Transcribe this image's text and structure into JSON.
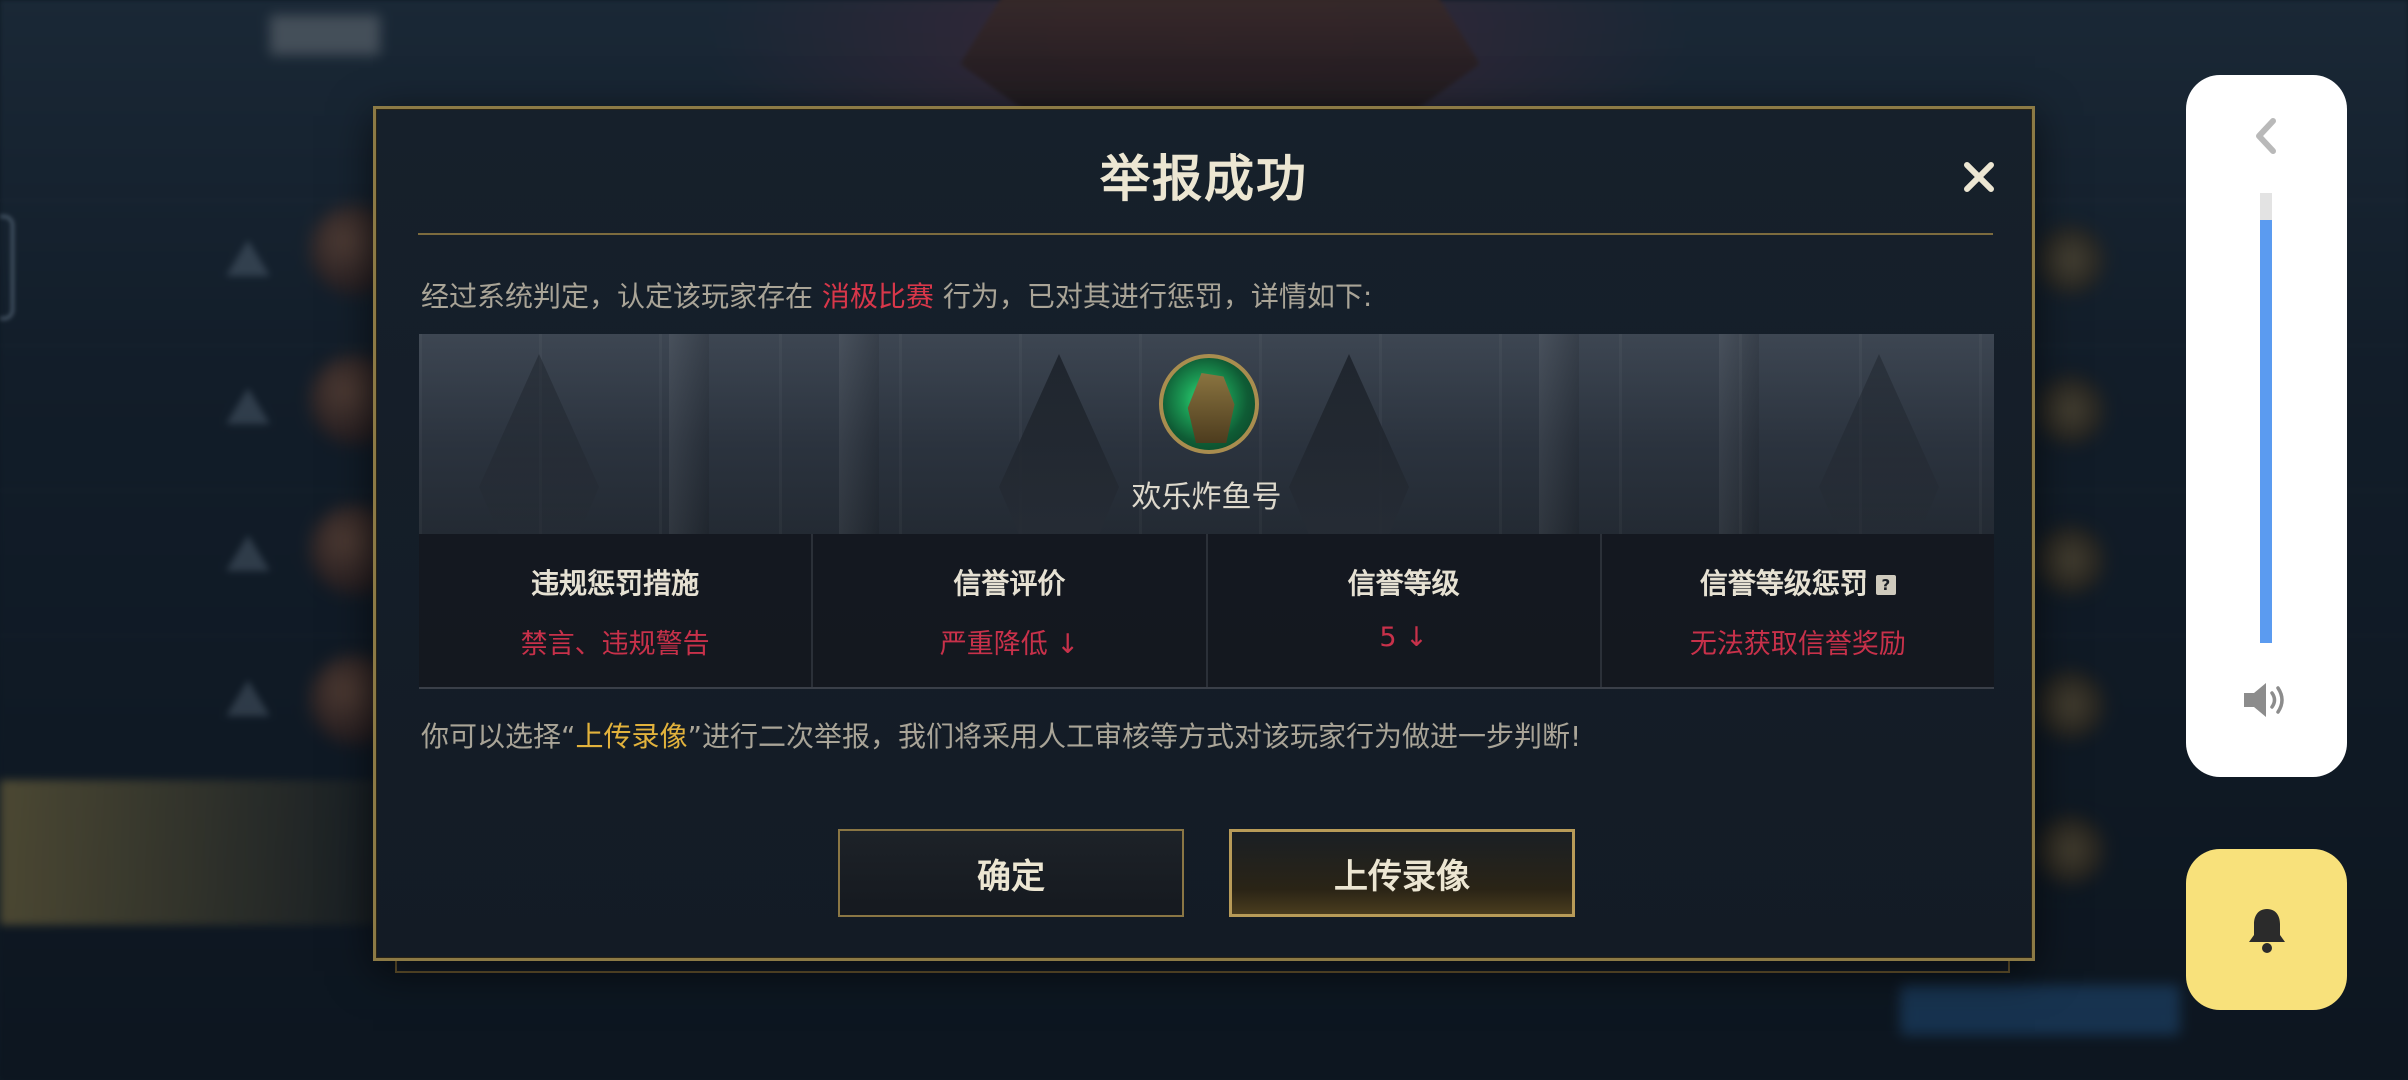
{
  "dialog": {
    "title": "举报成功",
    "verdict_prefix": "经过系统判定，认定该玩家存在 ",
    "verdict_highlight": "消极比赛",
    "verdict_suffix": " 行为，已对其进行惩罚，详情如下:",
    "player_name": "欢乐炸鱼号",
    "penalties": [
      {
        "label": "违规惩罚措施",
        "value": "禁言、违规警告"
      },
      {
        "label": "信誉评价",
        "value": "严重降低 ↓"
      },
      {
        "label": "信誉等级",
        "value": "5 ↓"
      },
      {
        "label": "信誉等级惩罚",
        "value": "无法获取信誉奖励",
        "help_icon": "?"
      }
    ],
    "note_prefix": "你可以选择“",
    "note_highlight": "上传录像",
    "note_suffix": "”进行二次举报，我们将采用人工审核等方式对该玩家行为做进一步判断!",
    "confirm_label": "确定",
    "upload_label": "上传录像"
  },
  "volume": {
    "level": 0.94
  },
  "colors": {
    "accent_gold": "#8c7a45",
    "penalty_red": "#c8314a",
    "highlight_gold": "#e2b23c",
    "volume_blue": "#5b9bf0",
    "bell_yellow": "#f8e17b"
  },
  "icons": {
    "close": "close-icon",
    "back": "chevron-left-icon",
    "volume": "speaker-icon",
    "bell": "bell-icon",
    "help": "help-icon"
  }
}
